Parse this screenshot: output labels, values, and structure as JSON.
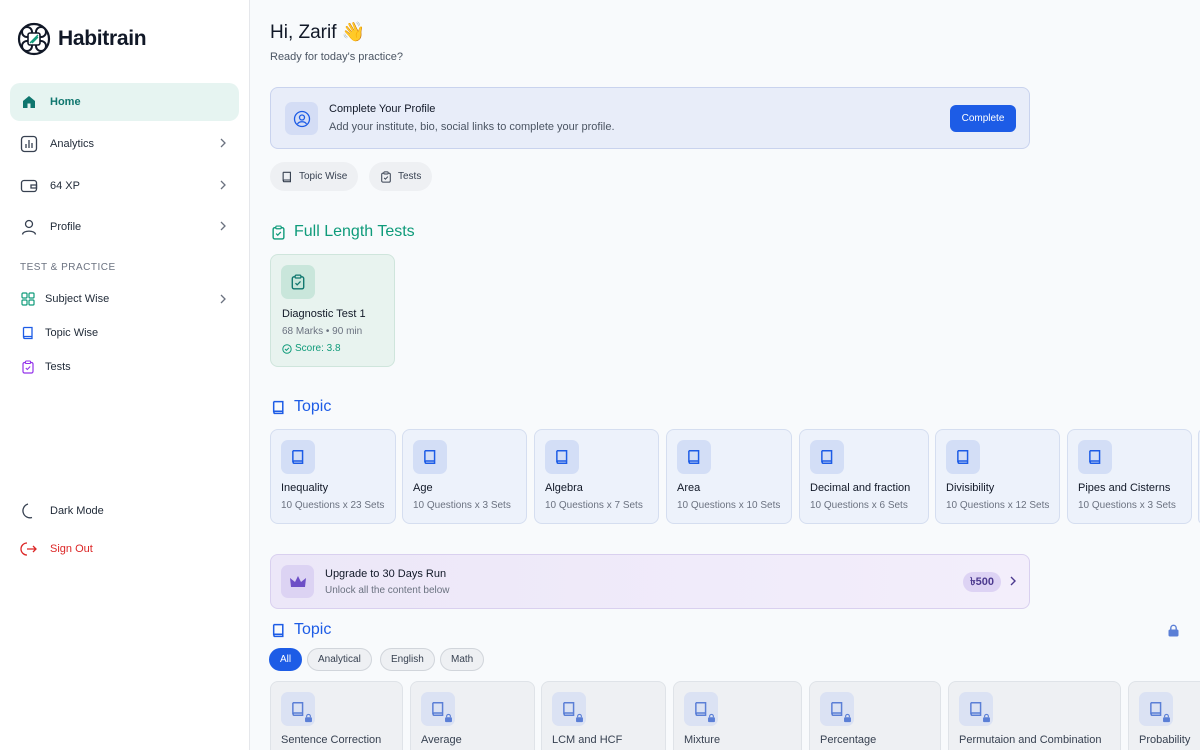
{
  "app": {
    "name": "Habitrain"
  },
  "sidebar": {
    "items": [
      {
        "label": "Home",
        "icon": "home-icon"
      },
      {
        "label": "Analytics",
        "icon": "chart-icon"
      },
      {
        "label": "64 XP",
        "icon": "wallet-icon"
      },
      {
        "label": "Profile",
        "icon": "user-icon"
      }
    ],
    "section_label": "TEST & PRACTICE",
    "sub_items": [
      {
        "label": "Subject Wise",
        "icon": "grid-icon"
      },
      {
        "label": "Topic Wise",
        "icon": "book-icon"
      },
      {
        "label": "Tests",
        "icon": "clipboard-icon"
      }
    ],
    "dark_mode": "Dark Mode",
    "sign_out": "Sign Out"
  },
  "header": {
    "greeting": "Hi, Zarif 👋",
    "subtitle": "Ready for today's practice?"
  },
  "profile_card": {
    "title": "Complete Your Profile",
    "subtitle": "Add your institute, bio, social links to complete your profile.",
    "button": "Complete"
  },
  "chips": [
    "Topic Wise",
    "Tests"
  ],
  "full_length": {
    "title": "Full Length Tests",
    "card": {
      "title": "Diagnostic Test 1",
      "meta": "68 Marks • 90 min",
      "score": "Score: 3.8"
    }
  },
  "topic": {
    "title": "Topic",
    "cards": [
      {
        "title": "Inequality",
        "meta": "10 Questions x 23 Sets"
      },
      {
        "title": "Age",
        "meta": "10 Questions x 3 Sets"
      },
      {
        "title": "Algebra",
        "meta": "10 Questions x 7 Sets"
      },
      {
        "title": "Area",
        "meta": "10 Questions x 10 Sets"
      },
      {
        "title": "Decimal and fraction",
        "meta": "10 Questions x 6 Sets"
      },
      {
        "title": "Divisibility",
        "meta": "10 Questions x 12 Sets"
      },
      {
        "title": "Pipes and Cisterns",
        "meta": "10 Questions x 3 Sets"
      }
    ]
  },
  "upgrade": {
    "title": "Upgrade to 30 Days Run",
    "subtitle": "Unlock all the content below",
    "price": "৳500"
  },
  "locked_topic": {
    "title": "Topic",
    "filters": [
      "All",
      "Analytical",
      "English",
      "Math"
    ],
    "cards": [
      "Sentence Correction",
      "Average",
      "LCM and HCF",
      "Mixture",
      "Percentage",
      "Permutaion and Combination",
      "Probability"
    ]
  },
  "colors": {
    "primary": "#1d5ce6",
    "teal": "#0f9b7a",
    "danger": "#dc2626"
  }
}
